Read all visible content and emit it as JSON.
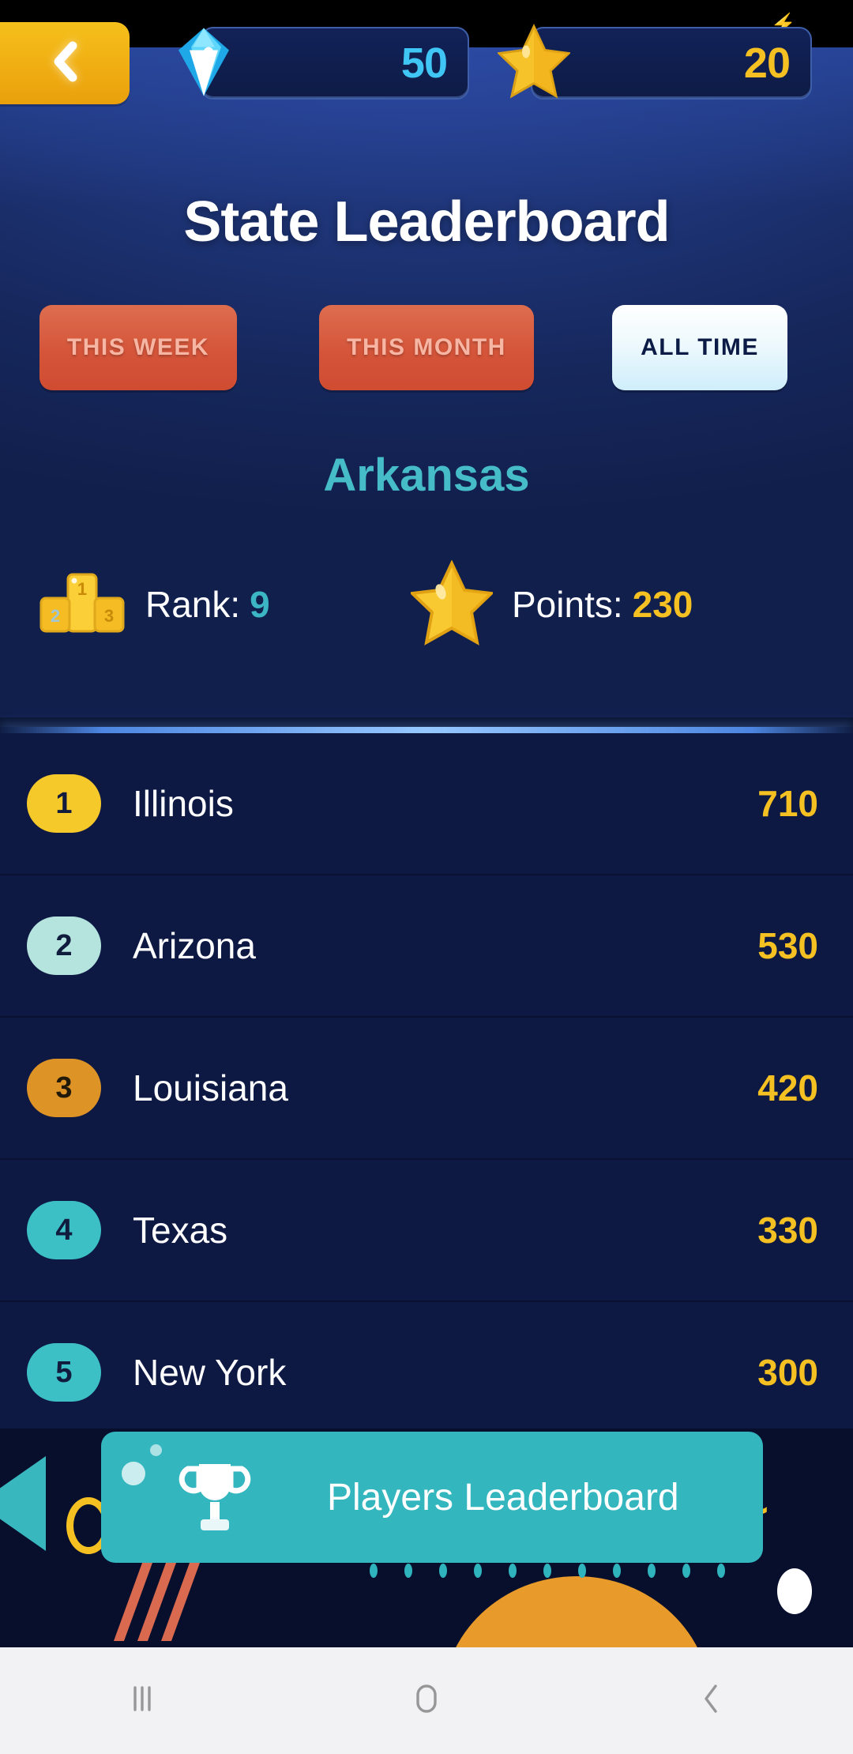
{
  "status_bar": {
    "charging_icon": "charging-bolt-icon"
  },
  "top_bar": {
    "back_label": "back-chevron-icon",
    "gem": {
      "icon": "gem-icon",
      "value": "50",
      "color": "#3fc6f5"
    },
    "star": {
      "icon": "star-icon",
      "value": "20",
      "color": "#f5c022"
    }
  },
  "header": {
    "title": "State Leaderboard",
    "tabs": [
      {
        "label": "THIS WEEK",
        "active": false
      },
      {
        "label": "THIS MONTH",
        "active": false
      },
      {
        "label": "ALL TIME",
        "active": true
      }
    ],
    "state_name": "Arkansas",
    "stats": {
      "rank": {
        "icon": "podium-icon",
        "label": "Rank:",
        "value": "9"
      },
      "points": {
        "icon": "star-icon",
        "label": "Points:",
        "value": "230"
      }
    }
  },
  "leaderboard": {
    "rows": [
      {
        "rank": "1",
        "name": "Illinois",
        "score": "710",
        "badge_color": "#f6c92a",
        "badge_text_color": "#111b3d"
      },
      {
        "rank": "2",
        "name": "Arizona",
        "score": "530",
        "badge_color": "#b4e4dd",
        "badge_text_color": "#111b3d"
      },
      {
        "rank": "3",
        "name": "Louisiana",
        "score": "420",
        "badge_color": "#dd9326",
        "badge_text_color": "#221a08"
      },
      {
        "rank": "4",
        "name": "Texas",
        "score": "330",
        "badge_color": "#3cc0c6",
        "badge_text_color": "#111b3d"
      },
      {
        "rank": "5",
        "name": "New York",
        "score": "300",
        "badge_color": "#3cc0c6",
        "badge_text_color": "#111b3d"
      }
    ]
  },
  "bottom": {
    "players_button": {
      "icon": "trophy-icon",
      "label": "Players Leaderboard",
      "color": "#34b6bf"
    }
  },
  "nav_bar": {
    "recents": "recents-icon",
    "home": "home-icon",
    "back": "back-icon"
  }
}
